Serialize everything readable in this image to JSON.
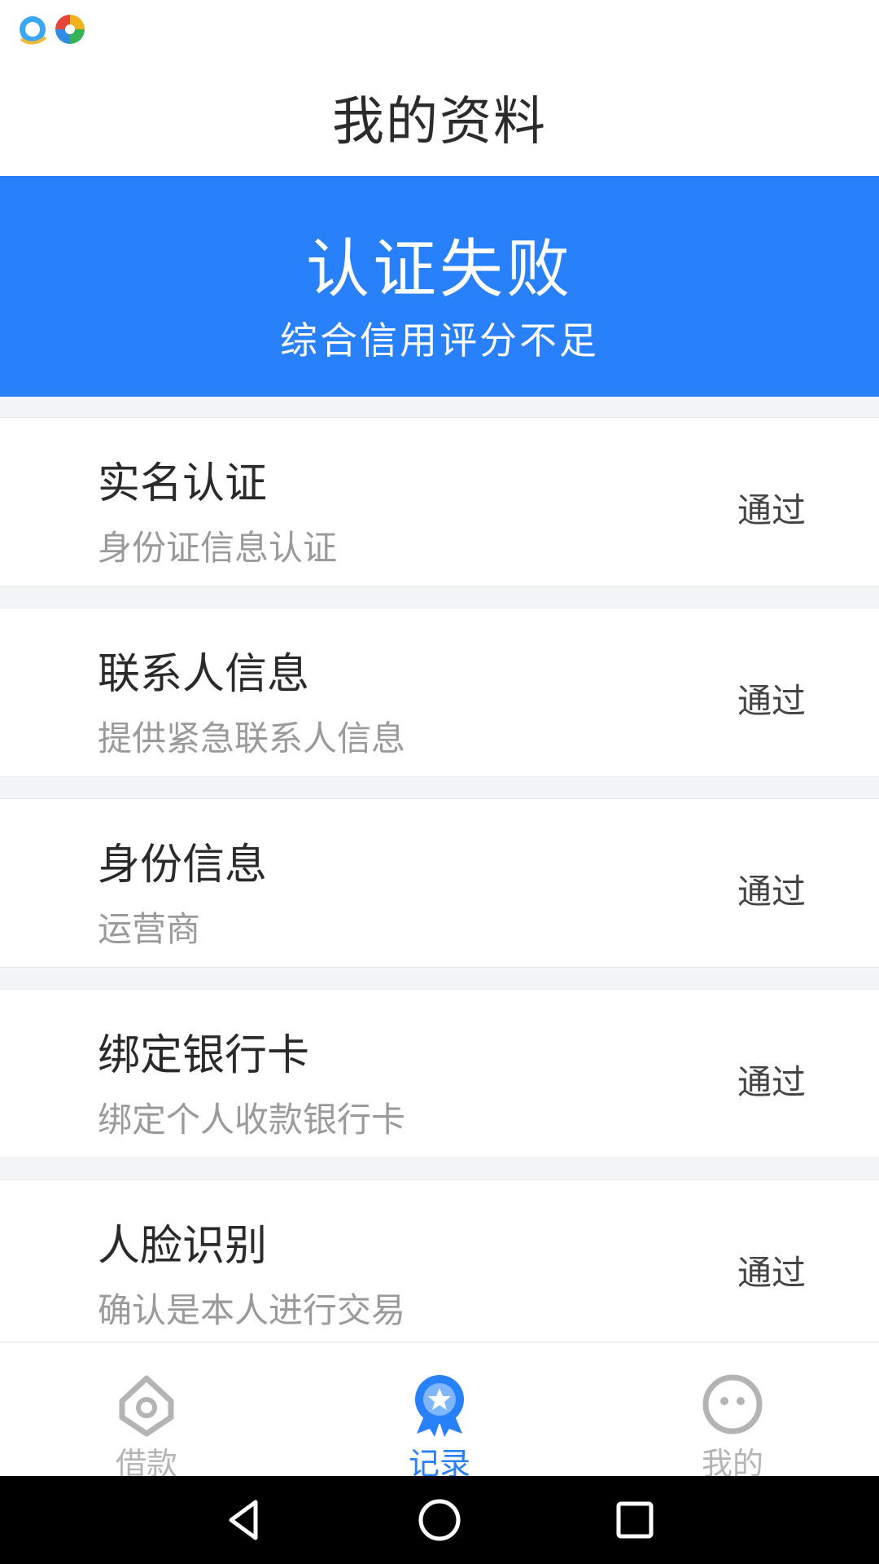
{
  "status_bar": {
    "icons": [
      "qq-browser-icon",
      "pinwheel-app-icon"
    ]
  },
  "header": {
    "title": "我的资料"
  },
  "banner": {
    "headline": "认证失败",
    "subline": "综合信用评分不足",
    "color": "#2980fb"
  },
  "items": [
    {
      "title": "实名认证",
      "desc": "身份证信息认证",
      "status": "通过"
    },
    {
      "title": "联系人信息",
      "desc": "提供紧急联系人信息",
      "status": "通过"
    },
    {
      "title": "身份信息",
      "desc": "运营商",
      "status": "通过"
    },
    {
      "title": "绑定银行卡",
      "desc": "绑定个人收款银行卡",
      "status": "通过"
    },
    {
      "title": "人脸识别",
      "desc": "确认是本人进行交易",
      "status": "通过"
    }
  ],
  "tabs": [
    {
      "label": "借款",
      "icon": "home-icon",
      "active": false
    },
    {
      "label": "记录",
      "icon": "medal-icon",
      "active": true
    },
    {
      "label": "我的",
      "icon": "smiley-icon",
      "active": false
    }
  ],
  "colors": {
    "tab_active": "#2980fb",
    "tab_inactive": "#b4b4b4"
  },
  "nav_bar": {
    "buttons": [
      "back-icon",
      "home-circle-icon",
      "recents-icon"
    ]
  }
}
